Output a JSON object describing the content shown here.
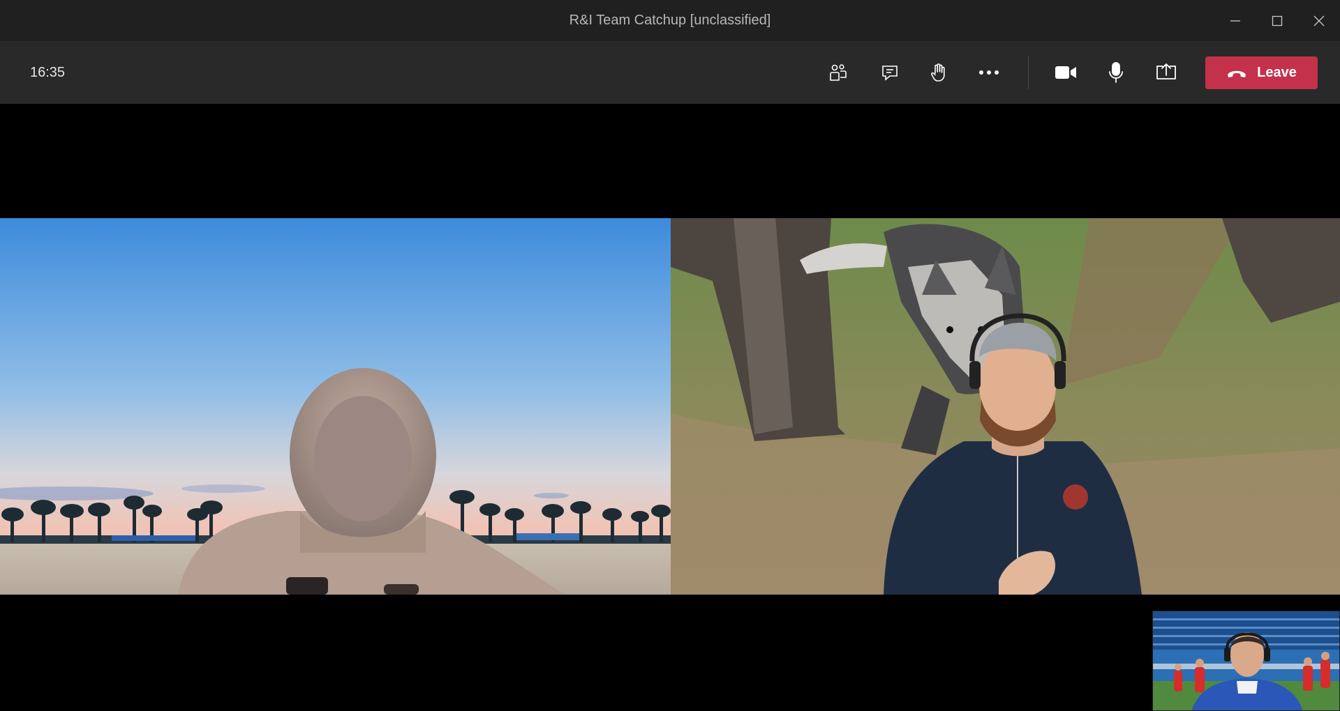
{
  "window": {
    "title": "R&I Team Catchup [unclassified]",
    "controls": [
      "minimize-icon",
      "maximize-icon",
      "close-icon"
    ]
  },
  "toolbar": {
    "time": "16:35",
    "buttons": [
      {
        "name": "participants",
        "icon": "people-icon"
      },
      {
        "name": "chat",
        "icon": "chat-icon"
      },
      {
        "name": "raise-hand",
        "icon": "hand-icon"
      },
      {
        "name": "more-actions",
        "icon": "more-icon"
      },
      {
        "name": "camera",
        "icon": "camera-icon"
      },
      {
        "name": "microphone",
        "icon": "microphone-icon"
      },
      {
        "name": "share",
        "icon": "share-screen-icon"
      }
    ],
    "leave_label": "Leave",
    "leave_color": "#c4314b"
  },
  "videos": [
    {
      "name": "participant-1-video",
      "background": "beach with palm trees at dusk"
    },
    {
      "name": "participant-2-video",
      "background": "forest with husky dog"
    },
    {
      "name": "self-view-video",
      "background": "football stadium"
    }
  ]
}
